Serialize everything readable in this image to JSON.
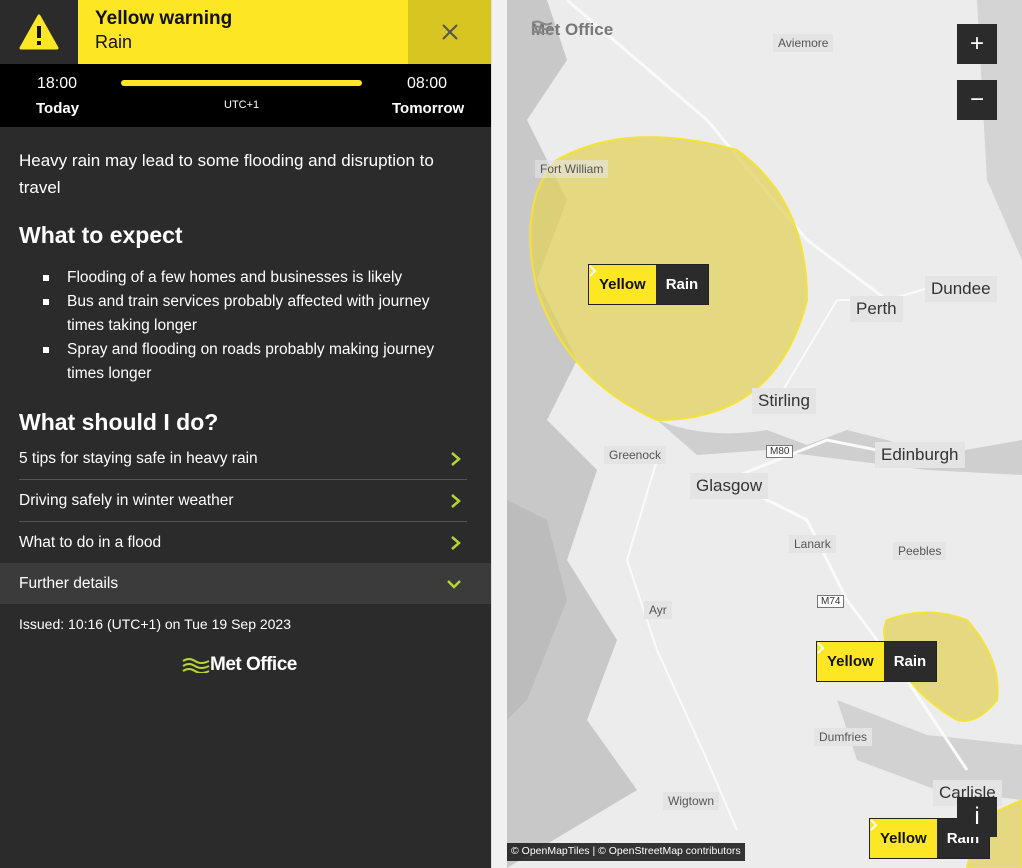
{
  "header": {
    "title": "Yellow warning",
    "subtitle": "Rain",
    "color_header": "#fde725",
    "color_dark": "#2b2b2b"
  },
  "timeline": {
    "start_time": "18:00",
    "start_day": "Today",
    "end_time": "08:00",
    "end_day": "Tomorrow",
    "timezone": "UTC+1"
  },
  "summary": "Heavy rain may lead to some flooding and disruption to travel",
  "expect": {
    "heading": "What to expect",
    "items": [
      "Flooding of a few homes and businesses is likely",
      "Bus and train services probably affected with journey times taking longer",
      "Spray and flooding on roads probably making journey times longer"
    ]
  },
  "todo": {
    "heading": "What should I do?",
    "links": [
      "5 tips for staying safe in heavy rain",
      "Driving safely in winter weather",
      "What to do in a flood"
    ]
  },
  "further": {
    "label": "Further details"
  },
  "issued": "Issued: 10:16 (UTC+1) on Tue 19 Sep 2023",
  "footer_logo": "Met Office",
  "map": {
    "logo": "Met Office",
    "places": [
      "Aviemore",
      "Fort William",
      "Perth",
      "Dundee",
      "Stirling",
      "Greenock",
      "Edinburgh",
      "Glasgow",
      "Lanark",
      "Peebles",
      "Ayr",
      "Dumfries",
      "Wigtown",
      "Carlisle"
    ],
    "roads": [
      "M80",
      "M74"
    ],
    "warning_tags": [
      {
        "level": "Yellow",
        "type": "Rain"
      },
      {
        "level": "Yellow",
        "type": "Rain"
      },
      {
        "level": "Yellow",
        "type": "Rain"
      }
    ],
    "zoom_in": "+",
    "zoom_out": "−",
    "info": "i",
    "attribution": "© OpenMapTiles | © OpenStreetMap contributors"
  }
}
